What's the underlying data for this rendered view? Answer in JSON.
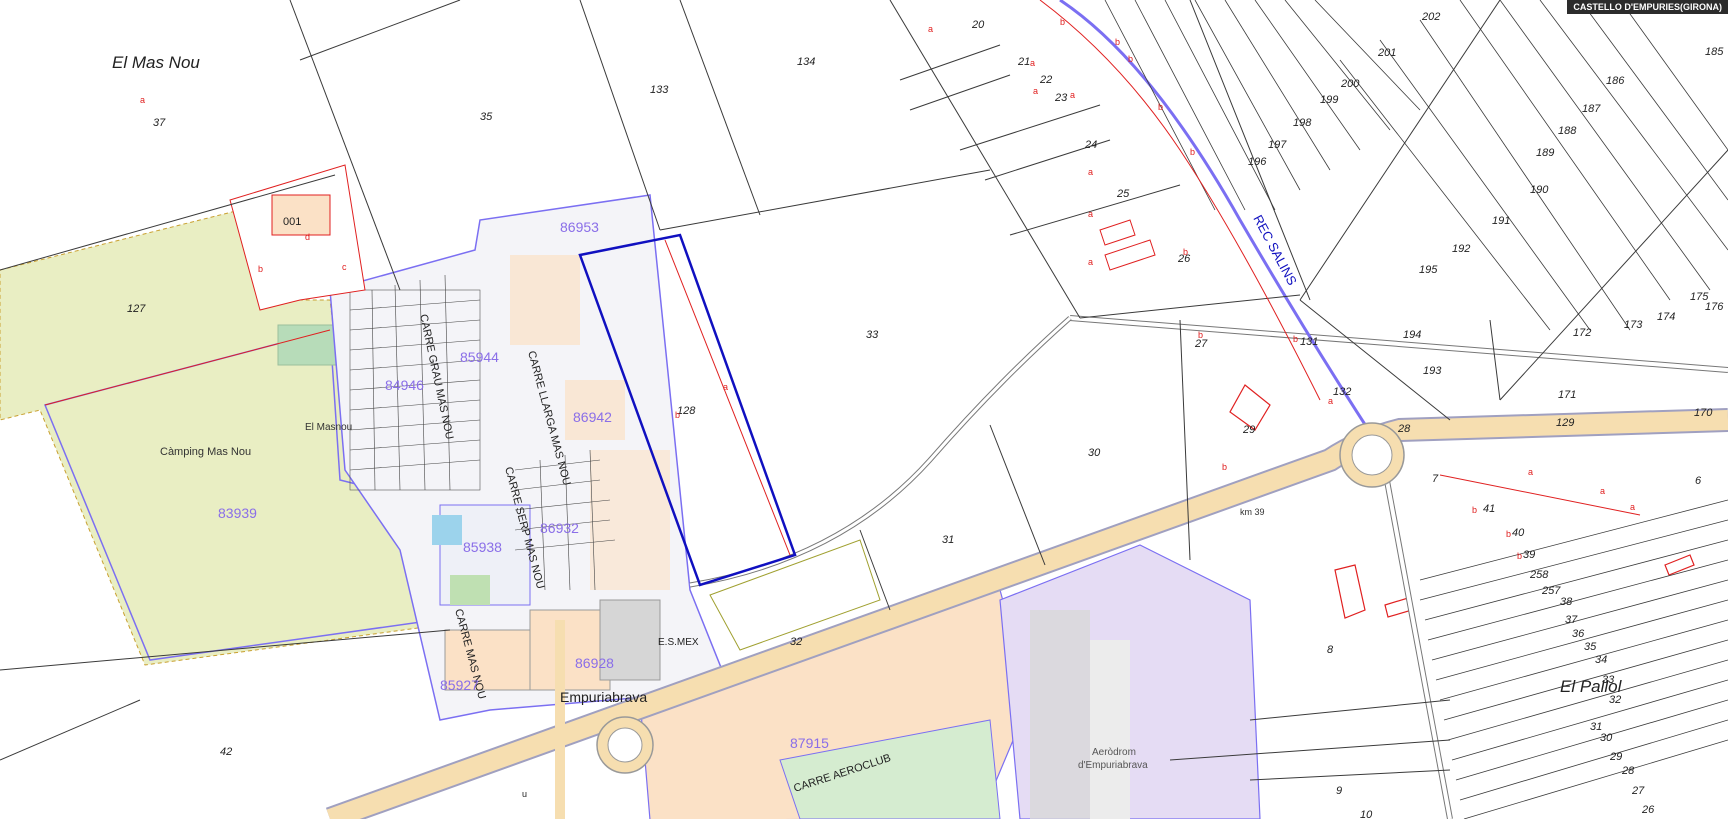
{
  "header": {
    "location": "CASTELLO D'EMPURIES(GIRONA)"
  },
  "places": {
    "el_mas_nou": "El Mas Nou",
    "camping": "Càmping Mas Nou",
    "el_masnou": "El Masnou",
    "empuriabrava": "Empuriabrava",
    "es_mex": "E.S.MEX",
    "aerodrom_1": "Aeròdrom",
    "aerodrom_2": "d'Empuriabrava",
    "el_pallol": "El Pallol",
    "km": "km 39"
  },
  "streets": {
    "grau": "CARRE GRAU MAS NOU",
    "llarga": "CARRE LLARGA MAS NOU",
    "serp": "CARRE SERP MAS NOU",
    "mas_nou": "CARRE MAS NOU",
    "aeroclub": "CARRE AEROCLUB",
    "rec_salins": "REC SALINS"
  },
  "blocks": {
    "b86953": "86953",
    "b85944": "85944",
    "b84946": "84946",
    "b86942": "86942",
    "b83939": "83939",
    "b86932": "86932",
    "b85938": "85938",
    "b86928": "86928",
    "b85927": "85927",
    "b87915": "87915"
  },
  "parcels": {
    "p37": "37",
    "p35": "35",
    "p133": "133",
    "p134": "134",
    "p20": "20",
    "p21": "21",
    "p22": "22",
    "p23": "23",
    "p24": "24",
    "p25": "25",
    "p26": "26",
    "p27": "27",
    "p33": "33",
    "p128": "128",
    "p127": "127",
    "p30": "30",
    "p31": "31",
    "p29": "29",
    "p32": "32",
    "p42": "42",
    "p8": "8",
    "p9": "9",
    "p10": "10",
    "p131": "131",
    "p132": "132",
    "p194": "194",
    "p193": "193",
    "p171": "171",
    "p170": "170",
    "p129": "129",
    "p28": "28",
    "p41": "41",
    "p40": "40",
    "p39": "39",
    "p258": "258",
    "p257": "257",
    "p38": "38",
    "p37b": "37",
    "p36": "36",
    "p35b": "35",
    "p34": "34",
    "p33b": "33",
    "p32b": "32",
    "p31b": "31",
    "p30b": "30",
    "p29b": "29",
    "p28b": "28",
    "p27b": "27",
    "p26b": "26",
    "p6": "6",
    "p7": "7",
    "p196": "196",
    "p197": "197",
    "p198": "198",
    "p199": "199",
    "p200": "200",
    "p201": "201",
    "p202": "202",
    "p186": "186",
    "p187": "187",
    "p188": "188",
    "p189": "189",
    "p190": "190",
    "p191": "191",
    "p192": "192",
    "p195": "195",
    "p172": "172",
    "p173": "173",
    "p174": "174",
    "p175": "175",
    "p176": "176",
    "p185": "185",
    "p001": "001"
  },
  "subparcels": {
    "a": "a",
    "b": "b",
    "c": "c",
    "d": "d",
    "u": "u"
  },
  "colors": {
    "camping_fill": "#e9eec3",
    "urban_fill": "#fbe1c6",
    "road_fill": "#f6deb0",
    "airport_fill": "#e5dcf4",
    "field_fill": "#d5ecd0",
    "urban_outline": "#7b6ff2",
    "block_label": "#8a6ee8",
    "cadastre_line": "#3a3a3a",
    "subparcel": "#e02020",
    "selected_parcel": "#1010c0"
  }
}
